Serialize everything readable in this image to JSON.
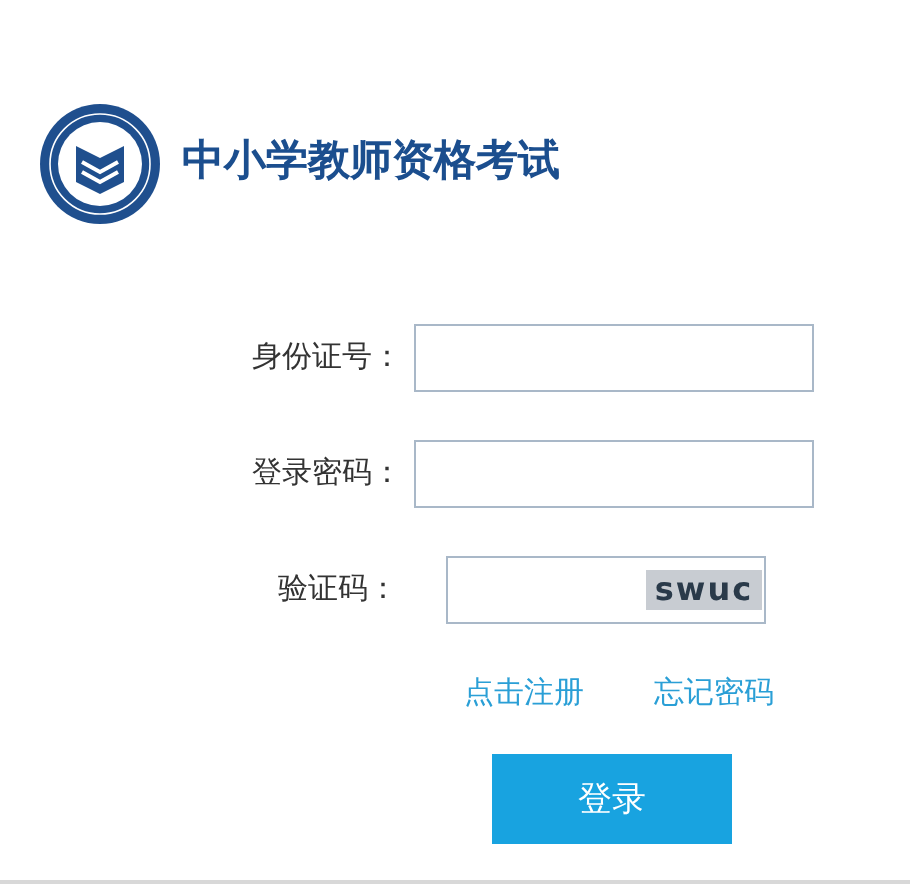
{
  "header": {
    "title": "中小学教师资格考试"
  },
  "form": {
    "fields": [
      {
        "kind": "text",
        "label": "身份证号："
      },
      {
        "kind": "password",
        "label": "登录密码："
      },
      {
        "kind": "captcha",
        "label": "验证码：",
        "captcha": "swuc"
      }
    ],
    "links": [
      "点击注册",
      "忘记密码"
    ],
    "submit": "登录"
  }
}
